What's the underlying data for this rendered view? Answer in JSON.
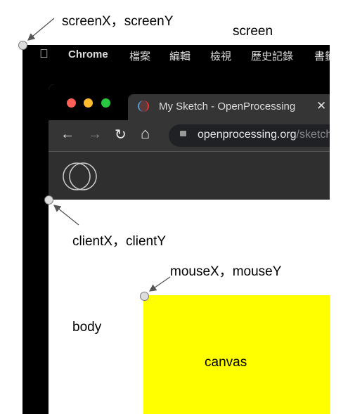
{
  "labels": {
    "screen_xy": "screenX，screenY",
    "screen": "screen",
    "client_xy": "clientX，clientY",
    "mouse_xy": "mouseX，mouseY",
    "body": "body",
    "canvas": "canvas"
  },
  "menubar": {
    "app": "Chrome",
    "items": [
      "檔案",
      "編輯",
      "檢視",
      "歷史記錄",
      "書籤"
    ]
  },
  "browser": {
    "tab_title": "My Sketch - OpenProcessing",
    "url_host": "openprocessing.org",
    "url_path": "/sketch"
  },
  "colors": {
    "canvas": "#ffff00",
    "close": "#ff5f57",
    "minimize": "#febc2e",
    "maximize": "#28c840"
  }
}
